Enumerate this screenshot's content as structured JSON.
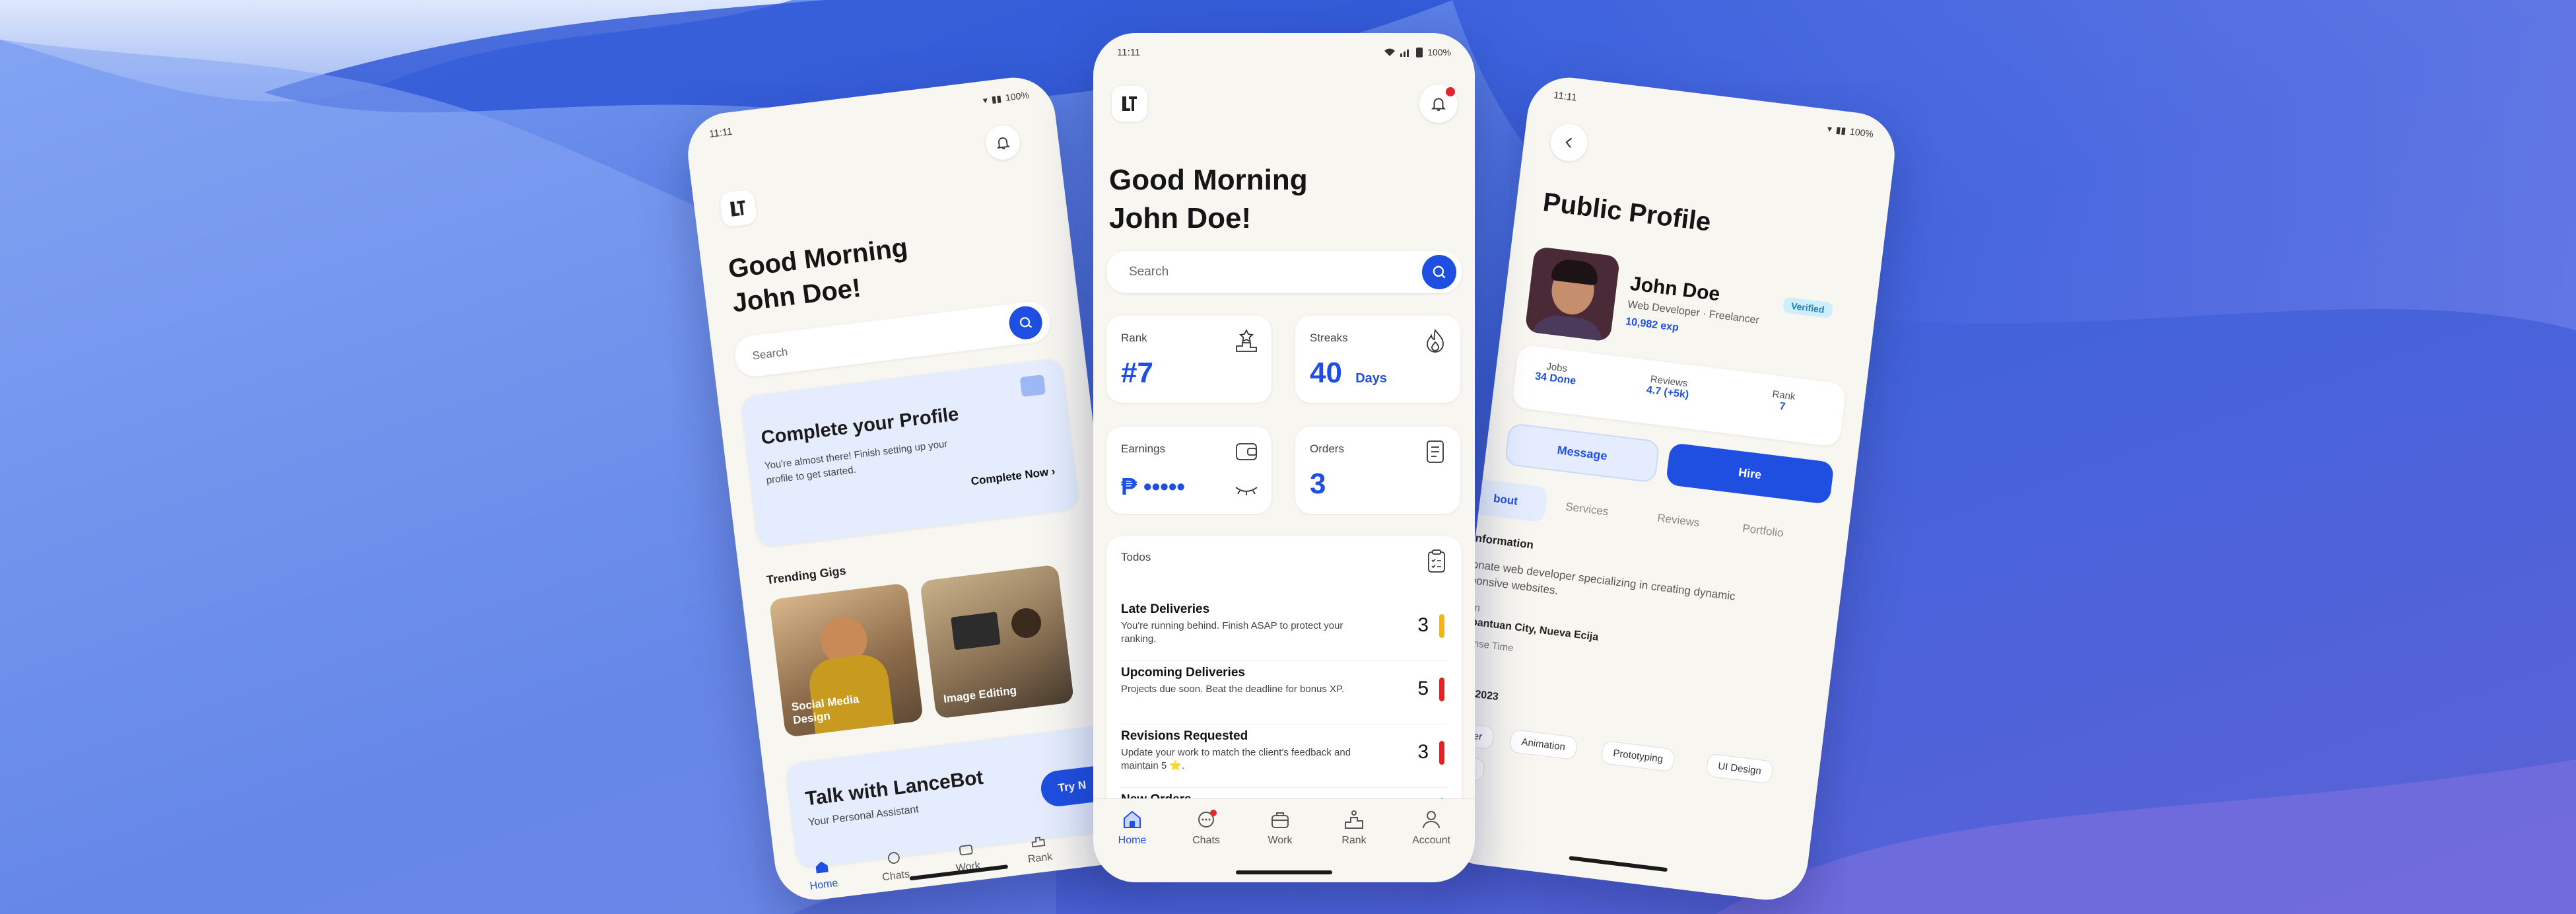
{
  "status": {
    "time": "11:11",
    "battery": "100%"
  },
  "home": {
    "greeting_line1": "Good Morning",
    "greeting_line2": "John Doe!",
    "search_placeholder": "Search",
    "stats": {
      "rank": {
        "label": "Rank",
        "value": "#7"
      },
      "streaks": {
        "label": "Streaks",
        "value": "40",
        "unit": "Days"
      },
      "earnings": {
        "label": "Earnings",
        "value": "₱ •••••"
      },
      "orders": {
        "label": "Orders",
        "value": "3"
      }
    },
    "todos": {
      "title": "Todos",
      "items": [
        {
          "title": "Late Deliveries",
          "desc": "You're running behind. Finish ASAP to protect your ranking.",
          "count": "3",
          "color": "#f2b51c"
        },
        {
          "title": "Upcoming Deliveries",
          "desc": "Projects due soon. Beat the deadline for bonus XP.",
          "count": "5",
          "color": "#e02424"
        },
        {
          "title": "Revisions Requested",
          "desc": "Update your work to match the client's feedback and maintain 5 ⭐.",
          "count": "3",
          "color": "#e02424"
        },
        {
          "title": "New Orders",
          "desc": "",
          "count": "",
          "color": "#2aa53a"
        }
      ]
    },
    "nav": [
      {
        "label": "Home",
        "icon": "home-icon",
        "active": true
      },
      {
        "label": "Chats",
        "icon": "chat-icon"
      },
      {
        "label": "Work",
        "icon": "briefcase-icon"
      },
      {
        "label": "Rank",
        "icon": "podium-icon"
      },
      {
        "label": "Account",
        "icon": "person-icon"
      }
    ]
  },
  "left": {
    "greeting_line1": "Good Morning",
    "greeting_line2": "John Doe!",
    "search_placeholder": "Search",
    "complete": {
      "title": "Complete your Profile",
      "desc_line1": "You're almost there! Finish setting up your",
      "desc_line2": "profile to get started.",
      "cta": "Complete Now"
    },
    "trending": {
      "title": "Trending Gigs",
      "gigs": [
        "Social Media Design",
        "Image Editing"
      ]
    },
    "lancebot": {
      "title": "Talk with LanceBot",
      "subtitle": "Your Personal Assistant",
      "cta": "Try N"
    },
    "nav": [
      "Home",
      "Chats",
      "Work",
      "Rank"
    ]
  },
  "profile": {
    "title": "Public Profile",
    "name": "John Doe",
    "role": "Web Developer · Freelancer",
    "exp": "10,982 exp",
    "badge": "Verified",
    "metrics": [
      {
        "label": "Jobs",
        "value": "34 Done"
      },
      {
        "label": "Reviews",
        "value": "4.7 (+5k)"
      },
      {
        "label": "Rank",
        "value": "7"
      }
    ],
    "message_btn": "Message",
    "hire_btn": "Hire",
    "tabs": [
      "bout",
      "Services",
      "Reviews",
      "Portfolio"
    ],
    "info_title": "nformation",
    "bio_line1": "onate web developer specializing in creating dynamic",
    "bio_line2": "ponsive websites.",
    "location_label": "ion",
    "location_value": "abantuan City, Nueva Ecija",
    "response_label": "ponse Time",
    "response_value": "rs",
    "joined_label": "ed",
    "joined_value": "r 1, 2023",
    "skills": [
      "oper",
      "Animation",
      "Prototyping",
      "UI Design",
      "her"
    ]
  },
  "colors": {
    "accent": "#1f4fe0",
    "bg": "#f7f6f0"
  }
}
